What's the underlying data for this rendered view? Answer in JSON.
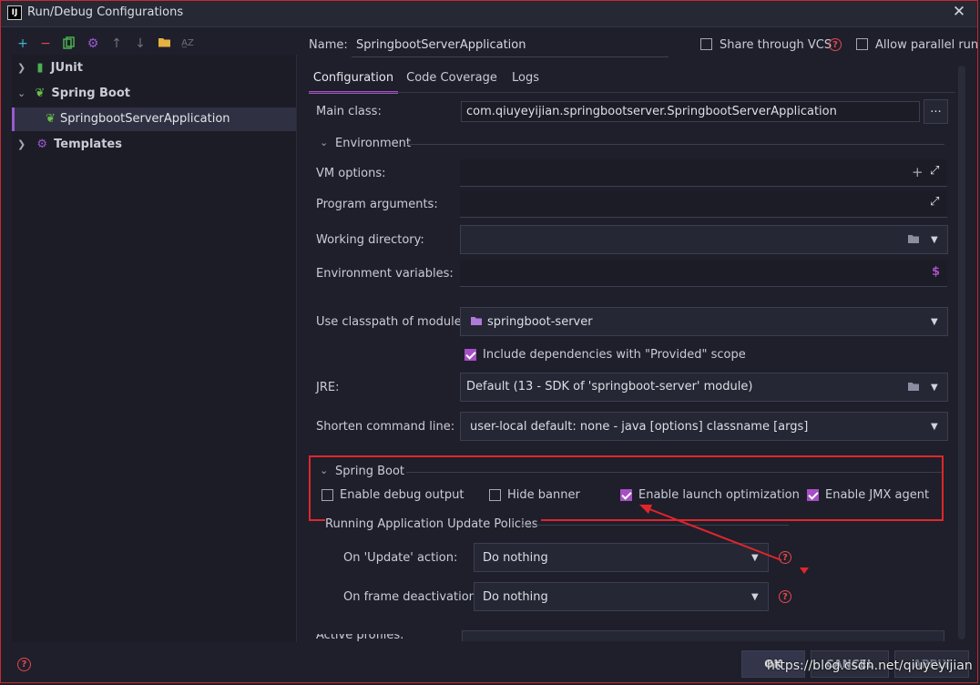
{
  "window": {
    "title": "Run/Debug Configurations",
    "app_icon": "IJ"
  },
  "toolbar": {
    "icons": [
      "add-icon",
      "remove-icon",
      "copy-icon",
      "settings-icon",
      "move-up-icon",
      "move-down-icon",
      "folder-icon",
      "sort-icon"
    ]
  },
  "tree": {
    "junit": "JUnit",
    "spring_boot": "Spring Boot",
    "app": "SpringbootServerApplication",
    "templates": "Templates"
  },
  "header": {
    "name_label": "Name:",
    "name_value": "SpringbootServerApplication",
    "share_label": "Share through VCS",
    "parallel_label": "Allow parallel run"
  },
  "tabs": [
    "Configuration",
    "Code Coverage",
    "Logs"
  ],
  "form": {
    "main_class_label": "Main class:",
    "main_class_value": "com.qiuyeyijian.springbootserver.SpringbootServerApplication",
    "browse_label": "...",
    "environment_label": "Environment",
    "vm_options_label": "VM options:",
    "program_args_label": "Program arguments:",
    "working_dir_label": "Working directory:",
    "env_vars_label": "Environment variables:",
    "classpath_label": "Use classpath of module:",
    "classpath_value": "springboot-server",
    "include_deps_label": "Include dependencies with \"Provided\" scope",
    "jre_label": "JRE:",
    "jre_value": "Default (13 - SDK of 'springboot-server' module)",
    "shorten_label": "Shorten command line:",
    "shorten_value": "user-local default: none - java [options] classname [args]"
  },
  "spring_boot_section": {
    "title": "Spring Boot",
    "debug_output": "Enable debug output",
    "hide_banner": "Hide banner",
    "launch_opt": "Enable launch optimization",
    "jmx_agent": "Enable JMX agent",
    "highlight_color": "#e0262b"
  },
  "update_policies": {
    "title": "Running Application Update Policies",
    "update_label": "On 'Update' action:",
    "update_value": "Do nothing",
    "frame_label": "On frame deactivation:",
    "frame_value": "Do nothing"
  },
  "active_profiles_label": "Active profiles:",
  "buttons": {
    "ok": "OK",
    "cancel": "CANCEL",
    "apply": "APPLY"
  },
  "watermark": "https://blog.csdn.net/qiuyeyijian",
  "colors": {
    "accent": "#a64fc4",
    "background": "#1e1f2b",
    "error": "#e5484d"
  }
}
